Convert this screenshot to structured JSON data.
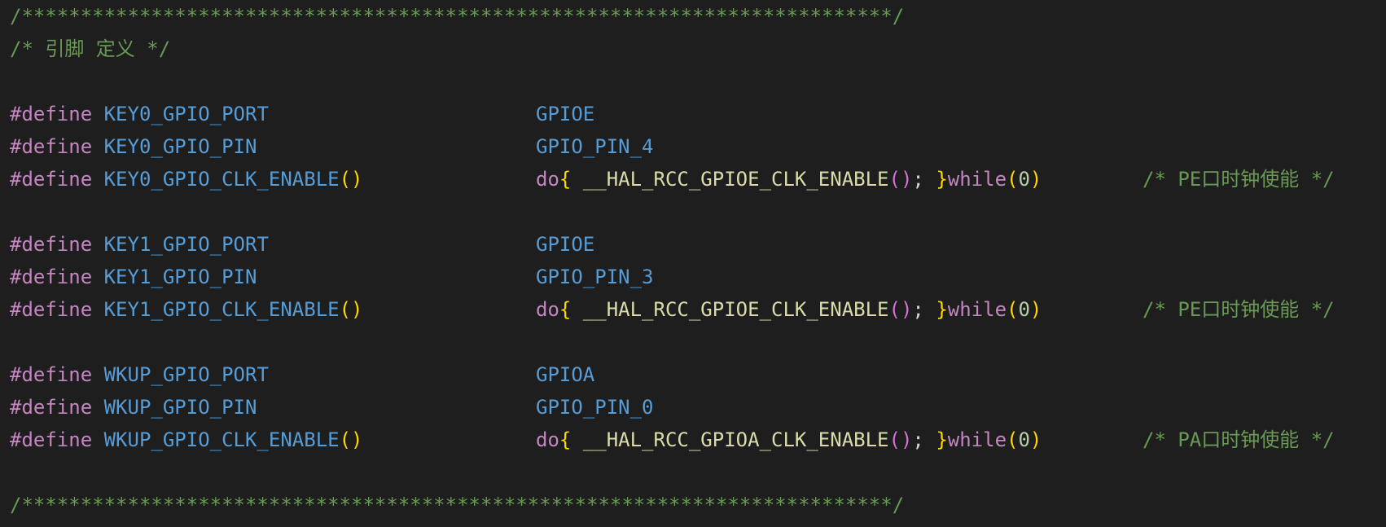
{
  "colors": {
    "background": "#1e1e1e",
    "comment": "#6a9955",
    "directive": "#c586c0",
    "macro": "#569cd6",
    "function": "#dcdcaa",
    "bracket_gold": "#ffd700",
    "bracket_orchid": "#da70d6",
    "number": "#b5cea8"
  },
  "header_separator": "/**************************************************************************/",
  "section_comment": "/* 引脚 定义 */",
  "footer_separator": "/**************************************************************************/",
  "define_keyword": "#define",
  "groups": [
    {
      "port_name": "KEY0_GPIO_PORT",
      "port_value": "GPIOE",
      "pin_name": "KEY0_GPIO_PIN",
      "pin_value": "GPIO_PIN_4",
      "clk_name": "KEY0_GPIO_CLK_ENABLE",
      "clk_parens": "()",
      "do_kw": "do",
      "brace_open": "{",
      "clk_func": " __HAL_RCC_GPIOE_CLK_ENABLE",
      "call_parens": "()",
      "semicolon": "; ",
      "brace_close": "}",
      "while_kw": "while",
      "while_open": "(",
      "while_arg": "0",
      "while_close": ")",
      "clk_comment": "/* PE口时钟使能 */"
    },
    {
      "port_name": "KEY1_GPIO_PORT",
      "port_value": "GPIOE",
      "pin_name": "KEY1_GPIO_PIN",
      "pin_value": "GPIO_PIN_3",
      "clk_name": "KEY1_GPIO_CLK_ENABLE",
      "clk_parens": "()",
      "do_kw": "do",
      "brace_open": "{",
      "clk_func": " __HAL_RCC_GPIOE_CLK_ENABLE",
      "call_parens": "()",
      "semicolon": "; ",
      "brace_close": "}",
      "while_kw": "while",
      "while_open": "(",
      "while_arg": "0",
      "while_close": ")",
      "clk_comment": "/* PE口时钟使能 */"
    },
    {
      "port_name": "WKUP_GPIO_PORT",
      "port_value": "GPIOA",
      "pin_name": "WKUP_GPIO_PIN",
      "pin_value": "GPIO_PIN_0",
      "clk_name": "WKUP_GPIO_CLK_ENABLE",
      "clk_parens": "()",
      "do_kw": "do",
      "brace_open": "{",
      "clk_func": " __HAL_RCC_GPIOA_CLK_ENABLE",
      "call_parens": "()",
      "semicolon": "; ",
      "brace_close": "}",
      "while_kw": "while",
      "while_open": "(",
      "while_arg": "0",
      "while_close": ")",
      "clk_comment": "/* PA口时钟使能 */"
    }
  ]
}
